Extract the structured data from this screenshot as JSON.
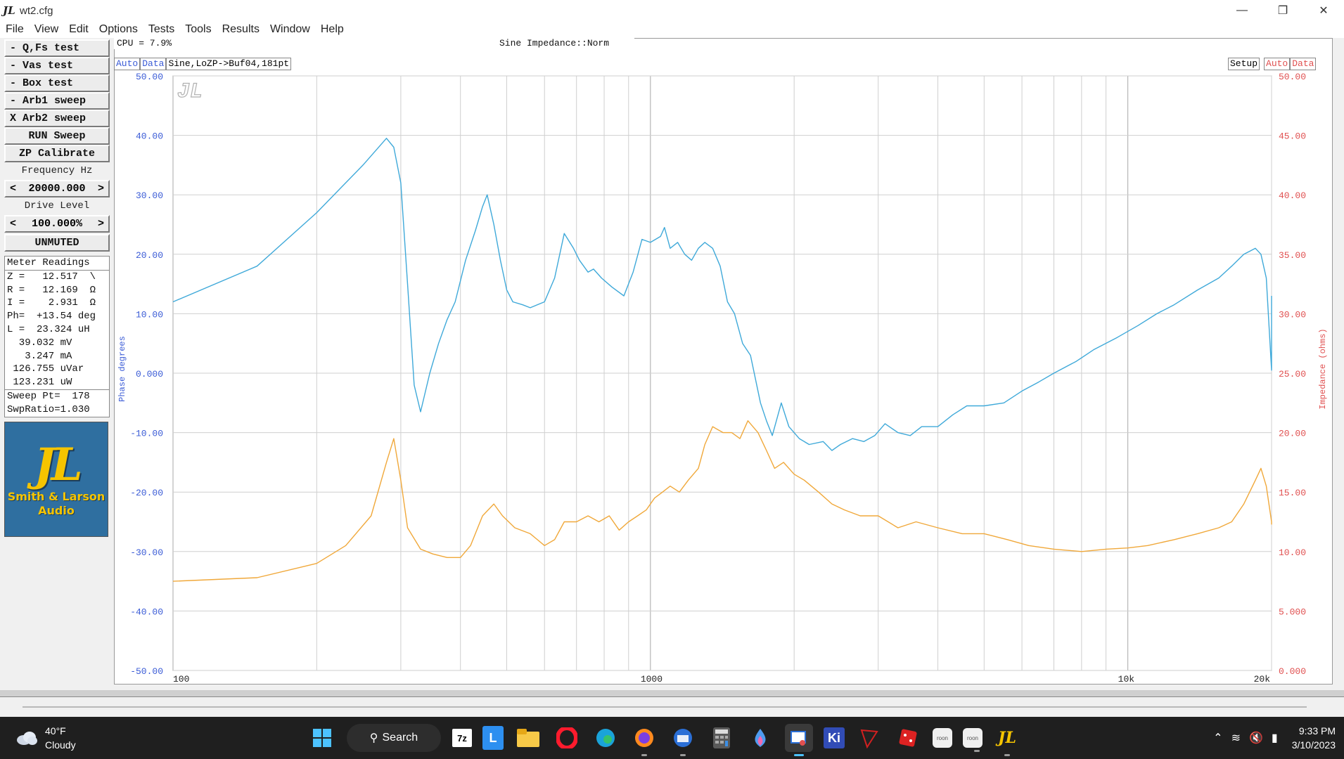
{
  "window": {
    "title": "wt2.cfg",
    "app_logo": "JL",
    "controls": [
      "—",
      "❐",
      "✕"
    ]
  },
  "menu": [
    "File",
    "View",
    "Edit",
    "Options",
    "Tests",
    "Tools",
    "Results",
    "Window",
    "Help"
  ],
  "left_panel": {
    "tests": [
      "- Q,Fs test",
      "- Vas test",
      "- Box test",
      "- Arb1 sweep",
      "X Arb2 sweep"
    ],
    "run_sweep": "RUN Sweep",
    "zp_calibrate": "ZP Calibrate",
    "frequency_label": "Frequency Hz",
    "frequency_value": "20000.000",
    "drive_label": "Drive Level",
    "drive_value": "100.000%",
    "mute_state": "UNMUTED",
    "spin_left": "<",
    "spin_right": ">",
    "meter": {
      "header": "Meter Readings",
      "rows": [
        "Z =   12.517  \\",
        "R =   12.169  Ω",
        "I =    2.931  Ω",
        "Ph=  +13.54 deg",
        "L =  23.324 uH",
        "  39.032 mV",
        "   3.247 mA",
        " 126.755 uVar",
        " 123.231 uW"
      ],
      "sweep_pt": "Sweep Pt=  178",
      "swp_ratio": "SwpRatio=1.030"
    },
    "logo": {
      "mark": "JL",
      "line1": "Smith & Larson",
      "line2": "Audio"
    }
  },
  "status": {
    "cpu": "CPU = 7.9%",
    "mode": "Sine Impedance::Norm"
  },
  "chart_toolbar": {
    "left_auto": "Auto",
    "left_data": "Data",
    "description": "Sine,LoZP->Buf04,181pt",
    "setup": "Setup",
    "right_auto": "Auto",
    "right_data": "Data"
  },
  "chart_data": {
    "type": "line",
    "x_scale": "log",
    "xlim": [
      100,
      20000
    ],
    "x_tick_labels": [
      {
        "value": 100,
        "label": "100"
      },
      {
        "value": 1000,
        "label": "1000"
      },
      {
        "value": 10000,
        "label": "10k"
      },
      {
        "value": 20000,
        "label": "20k"
      }
    ],
    "y_left": {
      "label": "Phase degrees",
      "ylim": [
        -50,
        50
      ],
      "ticks": [
        "50.00",
        "40.00",
        "30.00",
        "20.00",
        "10.00",
        "0.000",
        "-10.00",
        "-20.00",
        "-30.00",
        "-40.00",
        "-50.00"
      ],
      "color": "#3a5bd6"
    },
    "y_right": {
      "label": "Impedance (ohms)",
      "ylim": [
        0,
        50
      ],
      "ticks": [
        "50.00",
        "45.00",
        "40.00",
        "35.00",
        "30.00",
        "25.00",
        "20.00",
        "15.00",
        "10.00",
        "5.000",
        "0.000"
      ],
      "color": "#e05050"
    },
    "grid": true,
    "series": [
      {
        "axis": "left",
        "color": "#3fa9d9",
        "points": [
          [
            100,
            12
          ],
          [
            150,
            18
          ],
          [
            200,
            27
          ],
          [
            250,
            35
          ],
          [
            280,
            39.5
          ],
          [
            290,
            38
          ],
          [
            300,
            32
          ],
          [
            310,
            15
          ],
          [
            320,
            -2
          ],
          [
            330,
            -6.5
          ],
          [
            345,
            0
          ],
          [
            360,
            5
          ],
          [
            375,
            9
          ],
          [
            390,
            12
          ],
          [
            410,
            19
          ],
          [
            430,
            24
          ],
          [
            445,
            28
          ],
          [
            455,
            30
          ],
          [
            470,
            25
          ],
          [
            485,
            19
          ],
          [
            500,
            14
          ],
          [
            515,
            12
          ],
          [
            540,
            11.5
          ],
          [
            560,
            11
          ],
          [
            600,
            12
          ],
          [
            630,
            16
          ],
          [
            660,
            23.5
          ],
          [
            690,
            21
          ],
          [
            710,
            19
          ],
          [
            740,
            17
          ],
          [
            760,
            17.5
          ],
          [
            790,
            16
          ],
          [
            830,
            14.5
          ],
          [
            880,
            13
          ],
          [
            920,
            17
          ],
          [
            960,
            22.5
          ],
          [
            1000,
            22
          ],
          [
            1050,
            23
          ],
          [
            1070,
            24.5
          ],
          [
            1100,
            21
          ],
          [
            1140,
            22
          ],
          [
            1180,
            20
          ],
          [
            1220,
            19
          ],
          [
            1260,
            21
          ],
          [
            1300,
            22
          ],
          [
            1350,
            21
          ],
          [
            1400,
            18
          ],
          [
            1450,
            12
          ],
          [
            1500,
            10
          ],
          [
            1560,
            5
          ],
          [
            1620,
            3
          ],
          [
            1700,
            -5
          ],
          [
            1750,
            -8
          ],
          [
            1800,
            -10.5
          ],
          [
            1880,
            -5
          ],
          [
            1950,
            -9
          ],
          [
            2050,
            -11
          ],
          [
            2150,
            -12
          ],
          [
            2300,
            -11.5
          ],
          [
            2400,
            -13
          ],
          [
            2500,
            -12
          ],
          [
            2650,
            -11
          ],
          [
            2800,
            -11.5
          ],
          [
            2950,
            -10.5
          ],
          [
            3100,
            -8.5
          ],
          [
            3300,
            -10
          ],
          [
            3500,
            -10.5
          ],
          [
            3700,
            -9
          ],
          [
            4000,
            -9
          ],
          [
            4300,
            -7
          ],
          [
            4600,
            -5.5
          ],
          [
            5000,
            -5.5
          ],
          [
            5500,
            -5
          ],
          [
            6000,
            -3
          ],
          [
            6500,
            -1.5
          ],
          [
            7000,
            0
          ],
          [
            7800,
            2
          ],
          [
            8500,
            4
          ],
          [
            9500,
            6
          ],
          [
            10500,
            8
          ],
          [
            11500,
            10
          ],
          [
            12500,
            11.5
          ],
          [
            14000,
            14
          ],
          [
            15500,
            16
          ],
          [
            16500,
            18
          ],
          [
            17500,
            20
          ],
          [
            18500,
            21
          ],
          [
            19000,
            20
          ],
          [
            19500,
            16
          ],
          [
            20000,
            0.5
          ],
          [
            20500,
            6
          ],
          [
            21000,
            12
          ],
          [
            21500,
            13
          ]
        ]
      },
      {
        "axis": "right",
        "color": "#f0a83a",
        "points": [
          [
            100,
            7.5
          ],
          [
            150,
            7.8
          ],
          [
            200,
            9
          ],
          [
            230,
            10.5
          ],
          [
            260,
            13
          ],
          [
            280,
            17.5
          ],
          [
            290,
            19.5
          ],
          [
            300,
            16
          ],
          [
            310,
            12
          ],
          [
            330,
            10.2
          ],
          [
            350,
            9.8
          ],
          [
            375,
            9.5
          ],
          [
            400,
            9.5
          ],
          [
            420,
            10.5
          ],
          [
            445,
            13
          ],
          [
            470,
            14
          ],
          [
            490,
            13
          ],
          [
            520,
            12
          ],
          [
            560,
            11.5
          ],
          [
            600,
            10.5
          ],
          [
            630,
            11
          ],
          [
            660,
            12.5
          ],
          [
            700,
            12.5
          ],
          [
            740,
            13
          ],
          [
            780,
            12.5
          ],
          [
            820,
            13
          ],
          [
            860,
            11.8
          ],
          [
            900,
            12.5
          ],
          [
            940,
            13
          ],
          [
            980,
            13.5
          ],
          [
            1020,
            14.5
          ],
          [
            1060,
            15
          ],
          [
            1100,
            15.5
          ],
          [
            1150,
            15
          ],
          [
            1200,
            16
          ],
          [
            1260,
            17
          ],
          [
            1300,
            19
          ],
          [
            1350,
            20.5
          ],
          [
            1420,
            20
          ],
          [
            1480,
            20
          ],
          [
            1540,
            19.5
          ],
          [
            1600,
            21
          ],
          [
            1680,
            20
          ],
          [
            1750,
            18.5
          ],
          [
            1820,
            17
          ],
          [
            1900,
            17.5
          ],
          [
            2000,
            16.5
          ],
          [
            2100,
            16
          ],
          [
            2250,
            15
          ],
          [
            2400,
            14
          ],
          [
            2550,
            13.5
          ],
          [
            2750,
            13
          ],
          [
            3000,
            13
          ],
          [
            3300,
            12
          ],
          [
            3600,
            12.5
          ],
          [
            4000,
            12
          ],
          [
            4500,
            11.5
          ],
          [
            5000,
            11.5
          ],
          [
            5600,
            11
          ],
          [
            6200,
            10.5
          ],
          [
            7000,
            10.2
          ],
          [
            8000,
            10
          ],
          [
            9000,
            10.2
          ],
          [
            10000,
            10.3
          ],
          [
            11000,
            10.5
          ],
          [
            12500,
            11
          ],
          [
            14000,
            11.5
          ],
          [
            15500,
            12
          ],
          [
            16500,
            12.5
          ],
          [
            17500,
            14
          ],
          [
            18500,
            16
          ],
          [
            19000,
            17
          ],
          [
            19500,
            15.5
          ],
          [
            20000,
            12.5
          ],
          [
            20500,
            12.3
          ],
          [
            21000,
            12.5
          ],
          [
            21500,
            12.5
          ]
        ]
      }
    ]
  },
  "taskbar": {
    "weather_temp": "40°F",
    "weather_desc": "Cloudy",
    "search_label": "Search",
    "time": "9:33 PM",
    "date": "3/10/2023",
    "apps": [
      "start-icon",
      "7zip-icon",
      "lightshot-icon",
      "file-explorer-icon",
      "opera-icon",
      "edge-icon",
      "firefox-icon",
      "thunderbird-icon",
      "calculator-icon",
      "paint-icon",
      "snipping-tool-icon",
      "kicad-icon",
      "app-icon",
      "dice-icon",
      "roon-icon",
      "roon2-icon",
      "jl-icon"
    ]
  }
}
